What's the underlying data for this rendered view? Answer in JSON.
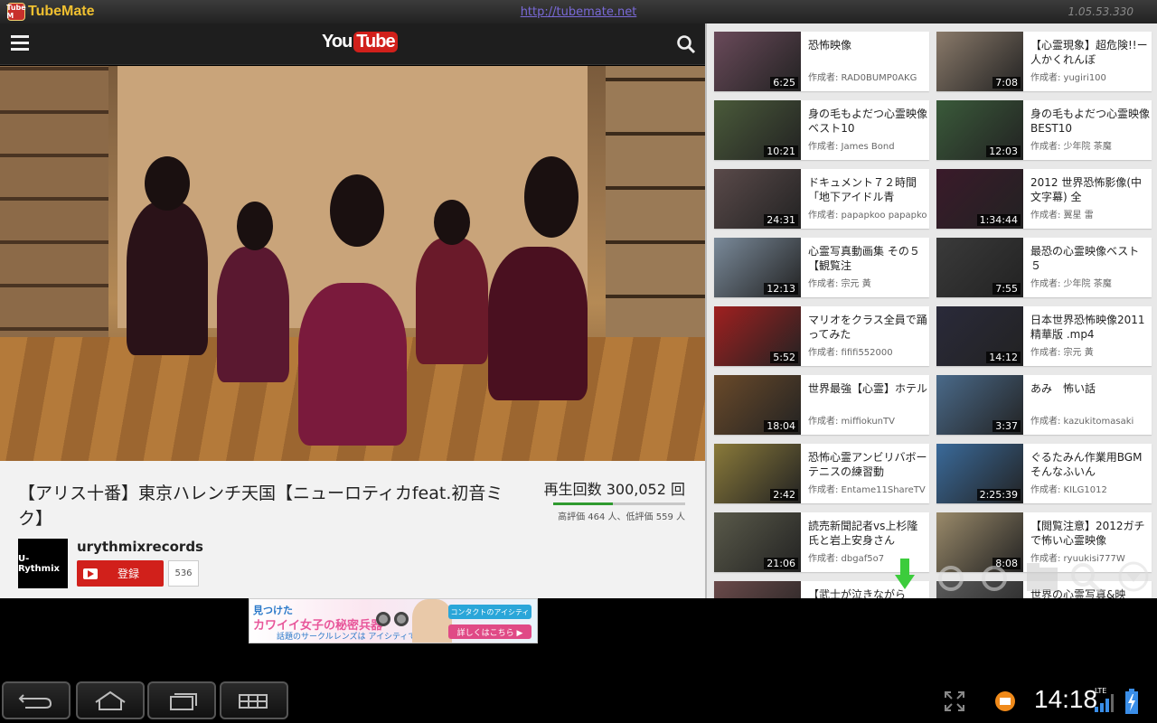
{
  "app": {
    "logo_badge": "Tube M",
    "name": "TubeMate",
    "url": "http://tubemate.net",
    "version": "1.05.53.330"
  },
  "header": {
    "brand_you": "You",
    "brand_tube": "Tube"
  },
  "video": {
    "title": "【アリス十番】東京ハレンチ天国【ニューロティカfeat.初音ミク】",
    "views": "再生回数 300,052 回",
    "like_ratio": 0.45,
    "rating": "高評価 464 人、低評価 559 人",
    "channel": "urythmixrecords",
    "channel_avatar_text": "U-Rythmix",
    "subscribe_label": "登録",
    "subscriber_count": "536"
  },
  "related": [
    {
      "title": "恐怖映像",
      "author": "作成者: RAD0BUMP0AKG",
      "duration": "6:25"
    },
    {
      "title": "【心霊現象】超危険!!ー人かくれんぼ",
      "author": "作成者: yugiri100",
      "duration": "7:08"
    },
    {
      "title": "身の毛もよだつ心霊映像ベスト10",
      "author": "作成者: James Bond",
      "duration": "10:21"
    },
    {
      "title": "身の毛もよだつ心霊映像BEST10",
      "author": "作成者: 少年院 茶魔",
      "duration": "12:03"
    },
    {
      "title": "ドキュメント７２時間「地下アイドル青",
      "author": "作成者: papapkoo papapkoo",
      "duration": "24:31"
    },
    {
      "title": "2012 世界恐怖影像(中文字幕) 全",
      "author": "作成者: 翼星 雷",
      "duration": "1:34:44"
    },
    {
      "title": "心霊写真動画集 その５【観覧注",
      "author": "作成者: 宗元 黃",
      "duration": "12:13"
    },
    {
      "title": "最恐の心霊映像ベスト５",
      "author": "作成者: 少年院 茶魔",
      "duration": "7:55"
    },
    {
      "title": "マリオをクラス全員で踊ってみた",
      "author": "作成者: fififi552000",
      "duration": "5:52"
    },
    {
      "title": "日本世界恐怖映像2011 精華版 .mp4",
      "author": "作成者: 宗元 黃",
      "duration": "14:12"
    },
    {
      "title": "世界最強【心霊】ホテル",
      "author": "作成者: miffiokunTV",
      "duration": "18:04"
    },
    {
      "title": "あみ　怖い話",
      "author": "作成者: kazukitomasaki",
      "duration": "3:37"
    },
    {
      "title": "恐怖心霊アンビリバボーテニスの練習動",
      "author": "作成者: Entame11ShareTV",
      "duration": "2:42"
    },
    {
      "title": "ぐるたみん作業用BGM　そんなふいん",
      "author": "作成者: KILG1012",
      "duration": "2:25:39"
    },
    {
      "title": "読売新聞記者vs上杉隆氏と岩上安身さん",
      "author": "作成者: dbgaf5o7",
      "duration": "21:06"
    },
    {
      "title": "【閲覧注意】2012ガチで怖い心霊映像",
      "author": "作成者: ryuukisi777W",
      "duration": "8:08"
    },
    {
      "title": "【武士が泣きながら",
      "author": "",
      "duration": ""
    },
    {
      "title": "世界の心霊写真&映",
      "author": "",
      "duration": ""
    }
  ],
  "ad": {
    "line1": "見つけた",
    "line2": "カワイイ女子の秘密兵器",
    "line3": "話題のサークルレンズは アイシティで",
    "brand": "コンタクトのアイシティ",
    "cta": "詳しくはこちら ▶"
  },
  "system": {
    "time": "14:18",
    "network": "LTE"
  },
  "colors": {
    "accent_red": "#d1201b",
    "like_green": "#2f9a2f",
    "logo_gold": "#f0c030"
  }
}
